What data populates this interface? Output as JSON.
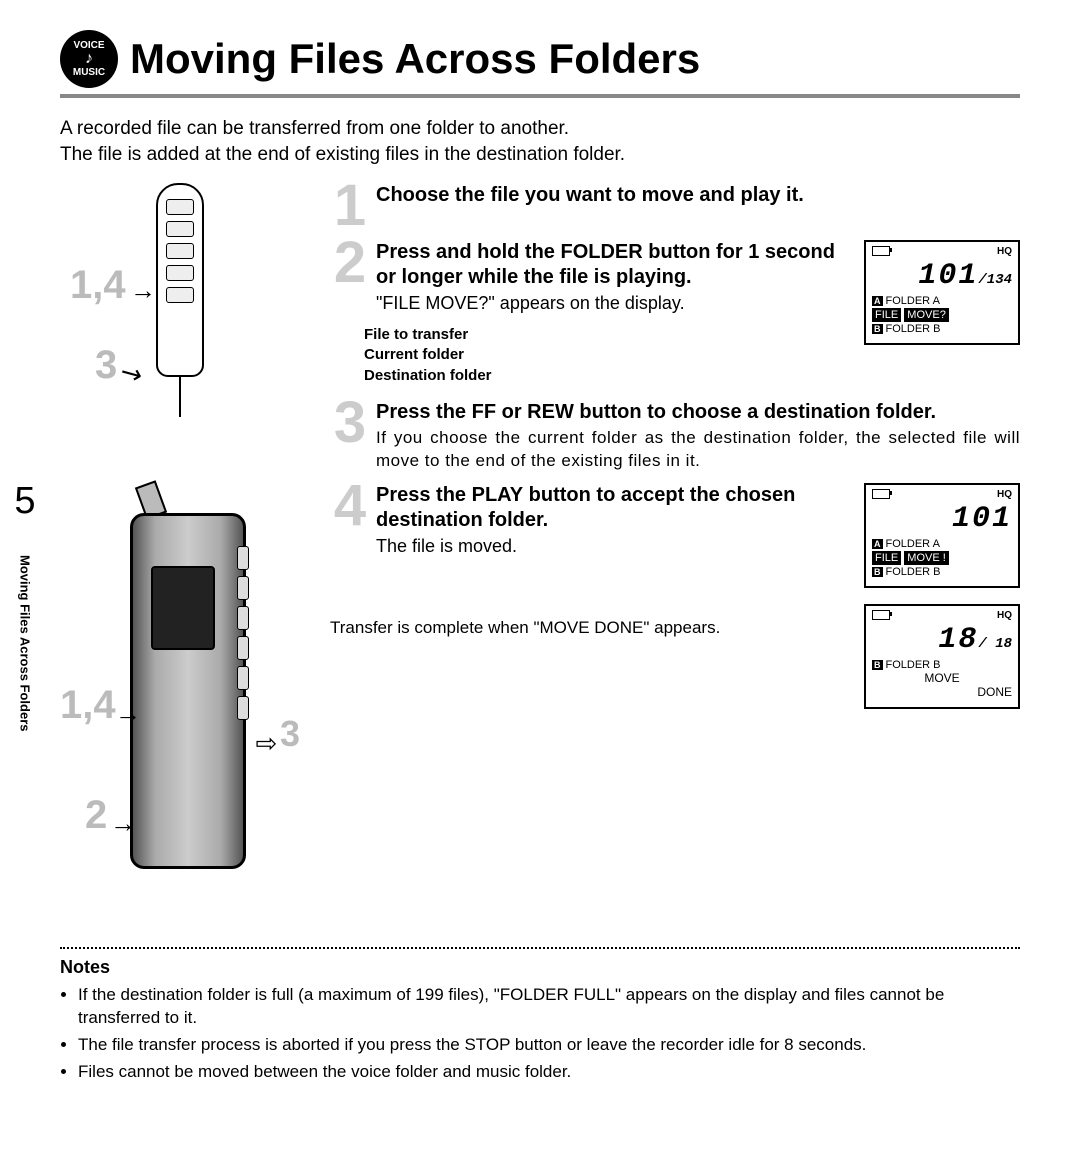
{
  "icon": {
    "top": "VOICE",
    "note": "♪",
    "bottom": "MUSIC"
  },
  "title": "Moving Files Across Folders",
  "intro_line1": "A recorded file can be transferred from one folder to another.",
  "intro_line2": "The file is added at the end of existing files in the destination folder.",
  "callouts": {
    "c14": "1,4",
    "c3": "3",
    "c2": "2"
  },
  "side_tab": {
    "chapter": "5",
    "title": "Moving Files Across Folders"
  },
  "steps": {
    "s1": {
      "num": "1",
      "title": "Choose the file you want to move and play it."
    },
    "s2": {
      "num": "2",
      "title_pre": "Press and hold the ",
      "title_bold1": "FOLDER",
      "title_post": " button for 1 second or longer while the file is playing.",
      "desc": "\"FILE MOVE?\" appears on the display.",
      "labels": {
        "l1": "File to transfer",
        "l2": "Current folder",
        "l3": "Destination folder"
      }
    },
    "s3": {
      "num": "3",
      "title_pre": "Press the ",
      "title_bold1": "FF",
      "title_mid": " or ",
      "title_bold2": "REW",
      "title_post": " button to choose a destination folder.",
      "desc": "If you choose the current folder as the destination folder, the selected file will move to the end of the existing files in it."
    },
    "s4": {
      "num": "4",
      "title_pre": "Press the ",
      "title_bold1": "PLAY",
      "title_post": " button to accept the chosen destination folder.",
      "desc": "The file is moved.",
      "done": "Transfer is complete when \"MOVE DONE\" appears."
    }
  },
  "lcd1": {
    "hq": "HQ",
    "big": "101",
    "big_sub": "/134",
    "folderA_tag": "A",
    "folderA": "FOLDER A",
    "inv1": "FILE",
    "inv2": "MOVE?",
    "folderB_tag": "B",
    "folderB": "FOLDER B"
  },
  "lcd2": {
    "hq": "HQ",
    "big": "101",
    "folderA_tag": "A",
    "folderA": "FOLDER A",
    "inv1": "FILE",
    "inv2": "MOVE !",
    "folderB_tag": "B",
    "folderB": "FOLDER B"
  },
  "lcd3": {
    "hq": "HQ",
    "big": "18",
    "big_sub": "/ 18",
    "folderB_tag": "B",
    "folderB": "FOLDER B",
    "line1": "MOVE",
    "line2": "DONE"
  },
  "notes": {
    "heading": "Notes",
    "n1": "If the destination folder is full (a maximum of 199 files), \"FOLDER FULL\" appears on the display and files cannot be transferred to it.",
    "n2": "The file transfer process is aborted if you press the STOP button or leave the recorder idle for 8 seconds.",
    "n3": "Files cannot be moved between the voice folder and music folder."
  }
}
